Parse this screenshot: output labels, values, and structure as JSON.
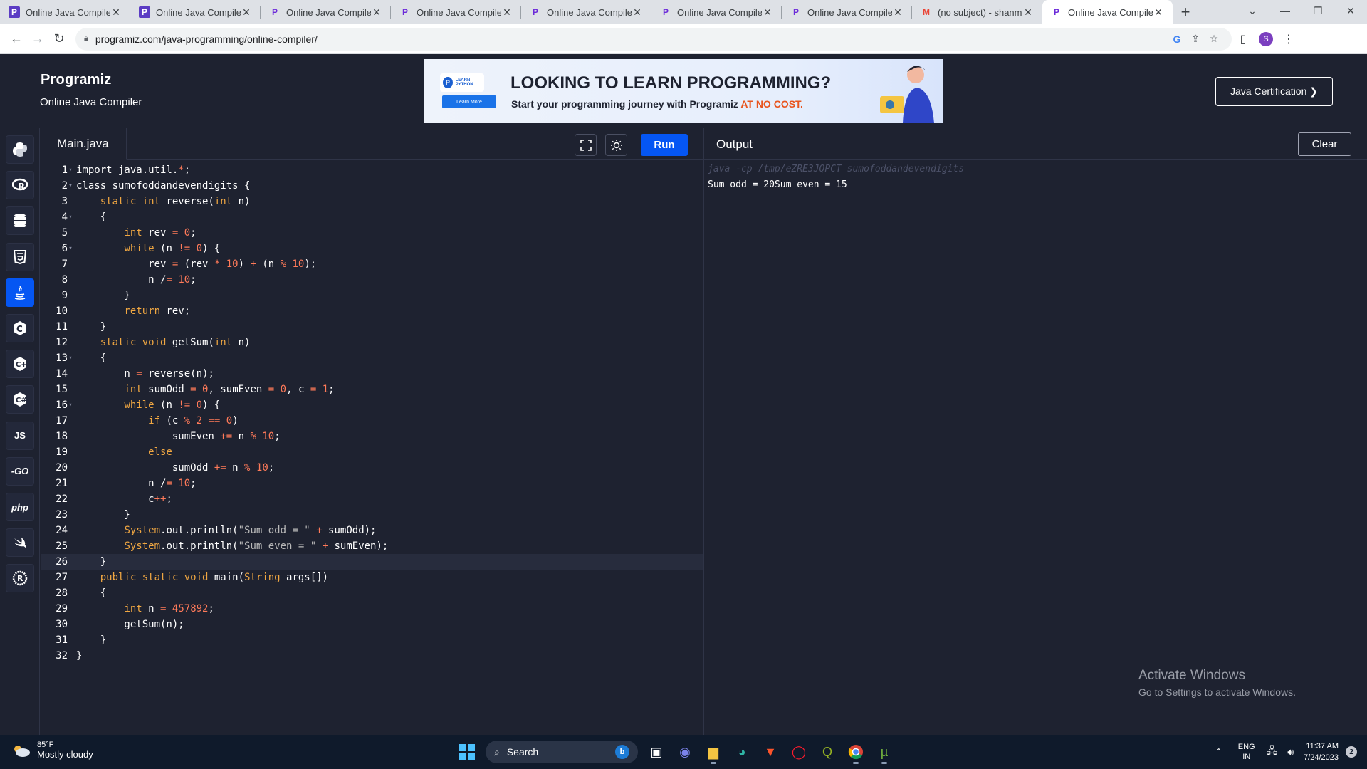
{
  "browser": {
    "tabs": [
      {
        "title": "Online Java Compiler",
        "favicon": "programiz-box-icon",
        "active": false
      },
      {
        "title": "Online Java Compiler",
        "favicon": "programiz-box-icon",
        "active": false
      },
      {
        "title": "Online Java Compiler",
        "favicon": "programiz-icon",
        "active": false
      },
      {
        "title": "Online Java Compiler",
        "favicon": "programiz-icon",
        "active": false
      },
      {
        "title": "Online Java Compiler",
        "favicon": "programiz-icon",
        "active": false
      },
      {
        "title": "Online Java Compiler",
        "favicon": "programiz-icon",
        "active": false
      },
      {
        "title": "Online Java Compiler",
        "favicon": "programiz-icon",
        "active": false
      },
      {
        "title": "(no subject) - shanmu",
        "favicon": "gmail-icon",
        "active": false
      },
      {
        "title": "Online Java Compiler",
        "favicon": "programiz-icon",
        "active": true
      }
    ],
    "url": "programiz.com/java-programming/online-compiler/",
    "profile_initial": "S"
  },
  "site": {
    "logo": "Programiz",
    "subtitle": "Online Java Compiler",
    "banner": {
      "badge": "LEARN PYTHON",
      "learn_more": "Learn More",
      "title": "LOOKING TO LEARN PROGRAMMING?",
      "subtitle_prefix": "Start your programming journey with Programiz ",
      "subtitle_highlight": "AT NO COST.",
      "highlight_color": "#e8541e"
    },
    "certification_button": "Java Certification ❯"
  },
  "sidebar": {
    "languages": [
      {
        "name": "python-icon",
        "label": "",
        "active": false
      },
      {
        "name": "r-icon",
        "label": "",
        "active": false
      },
      {
        "name": "sql-icon",
        "label": "",
        "active": false
      },
      {
        "name": "html-icon",
        "label": "",
        "active": false
      },
      {
        "name": "java-icon",
        "label": "",
        "active": true
      },
      {
        "name": "c-icon",
        "label": "",
        "active": false
      },
      {
        "name": "cpp-icon",
        "label": "",
        "active": false
      },
      {
        "name": "csharp-icon",
        "label": "",
        "active": false
      },
      {
        "name": "javascript-icon",
        "label": "JS",
        "active": false
      },
      {
        "name": "go-icon",
        "label": "-GO",
        "active": false
      },
      {
        "name": "php-icon",
        "label": "php",
        "active": false
      },
      {
        "name": "swift-icon",
        "label": "",
        "active": false
      },
      {
        "name": "rust-icon",
        "label": "",
        "active": false
      }
    ],
    "accent": "#0556f3"
  },
  "editor": {
    "file_tab": "Main.java",
    "run_label": "Run",
    "cursor_line": 26,
    "lines": [
      [
        [
          "import java.util.",
          ""
        ],
        [
          "*",
          "o"
        ],
        [
          ";",
          ""
        ]
      ],
      [
        [
          "class sumofoddandevendigits {",
          ""
        ]
      ],
      [
        [
          "    ",
          ""
        ],
        [
          "static int",
          "k"
        ],
        [
          " reverse(",
          ""
        ],
        [
          "int",
          "k"
        ],
        [
          " n)",
          ""
        ]
      ],
      [
        [
          "    {",
          ""
        ]
      ],
      [
        [
          "        ",
          ""
        ],
        [
          "int",
          "k"
        ],
        [
          " rev ",
          ""
        ],
        [
          "=",
          "o"
        ],
        [
          " ",
          ""
        ],
        [
          "0",
          "n"
        ],
        [
          ";",
          ""
        ]
      ],
      [
        [
          "        ",
          ""
        ],
        [
          "while",
          "k"
        ],
        [
          " (n ",
          ""
        ],
        [
          "!=",
          "o"
        ],
        [
          " ",
          ""
        ],
        [
          "0",
          "n"
        ],
        [
          ") {",
          ""
        ]
      ],
      [
        [
          "            rev ",
          ""
        ],
        [
          "=",
          "o"
        ],
        [
          " (rev ",
          ""
        ],
        [
          "*",
          "o"
        ],
        [
          " ",
          ""
        ],
        [
          "10",
          "n"
        ],
        [
          ") ",
          ""
        ],
        [
          "+",
          "o"
        ],
        [
          " (n ",
          ""
        ],
        [
          "%",
          "o"
        ],
        [
          " ",
          ""
        ],
        [
          "10",
          "n"
        ],
        [
          ");",
          ""
        ]
      ],
      [
        [
          "            n /",
          ""
        ],
        [
          "=",
          "o"
        ],
        [
          " ",
          ""
        ],
        [
          "10",
          "n"
        ],
        [
          ";",
          ""
        ]
      ],
      [
        [
          "        }",
          ""
        ]
      ],
      [
        [
          "        ",
          ""
        ],
        [
          "return",
          "k"
        ],
        [
          " rev;",
          ""
        ]
      ],
      [
        [
          "    }",
          ""
        ]
      ],
      [
        [
          "    ",
          ""
        ],
        [
          "static void",
          "k"
        ],
        [
          " getSum(",
          ""
        ],
        [
          "int",
          "k"
        ],
        [
          " n)",
          ""
        ]
      ],
      [
        [
          "    {",
          ""
        ]
      ],
      [
        [
          "        n ",
          ""
        ],
        [
          "=",
          "o"
        ],
        [
          " reverse(n);",
          ""
        ]
      ],
      [
        [
          "        ",
          ""
        ],
        [
          "int",
          "k"
        ],
        [
          " sumOdd ",
          ""
        ],
        [
          "=",
          "o"
        ],
        [
          " ",
          ""
        ],
        [
          "0",
          "n"
        ],
        [
          ", sumEven ",
          ""
        ],
        [
          "=",
          "o"
        ],
        [
          " ",
          ""
        ],
        [
          "0",
          "n"
        ],
        [
          ", c ",
          ""
        ],
        [
          "=",
          "o"
        ],
        [
          " ",
          ""
        ],
        [
          "1",
          "n"
        ],
        [
          ";",
          ""
        ]
      ],
      [
        [
          "        ",
          ""
        ],
        [
          "while",
          "k"
        ],
        [
          " (n ",
          ""
        ],
        [
          "!=",
          "o"
        ],
        [
          " ",
          ""
        ],
        [
          "0",
          "n"
        ],
        [
          ") {",
          ""
        ]
      ],
      [
        [
          "            ",
          ""
        ],
        [
          "if",
          "k"
        ],
        [
          " (c ",
          ""
        ],
        [
          "%",
          "o"
        ],
        [
          " ",
          ""
        ],
        [
          "2",
          "n"
        ],
        [
          " ",
          ""
        ],
        [
          "==",
          "o"
        ],
        [
          " ",
          ""
        ],
        [
          "0",
          "n"
        ],
        [
          ")",
          ""
        ]
      ],
      [
        [
          "                sumEven ",
          ""
        ],
        [
          "+=",
          "o"
        ],
        [
          " n ",
          ""
        ],
        [
          "%",
          "o"
        ],
        [
          " ",
          ""
        ],
        [
          "10",
          "n"
        ],
        [
          ";",
          ""
        ]
      ],
      [
        [
          "            ",
          ""
        ],
        [
          "else",
          "k"
        ]
      ],
      [
        [
          "                sumOdd ",
          ""
        ],
        [
          "+=",
          "o"
        ],
        [
          " n ",
          ""
        ],
        [
          "%",
          "o"
        ],
        [
          " ",
          ""
        ],
        [
          "10",
          "n"
        ],
        [
          ";",
          ""
        ]
      ],
      [
        [
          "            n /",
          ""
        ],
        [
          "=",
          "o"
        ],
        [
          " ",
          ""
        ],
        [
          "10",
          "n"
        ],
        [
          ";",
          ""
        ]
      ],
      [
        [
          "            c",
          ""
        ],
        [
          "++",
          "o"
        ],
        [
          ";",
          ""
        ]
      ],
      [
        [
          "        }",
          ""
        ]
      ],
      [
        [
          "        ",
          ""
        ],
        [
          "System",
          "k"
        ],
        [
          ".out.println(",
          ""
        ],
        [
          "\"Sum odd = \"",
          "s"
        ],
        [
          " ",
          ""
        ],
        [
          "+",
          "o"
        ],
        [
          " sumOdd);",
          ""
        ]
      ],
      [
        [
          "        ",
          ""
        ],
        [
          "System",
          "k"
        ],
        [
          ".out.println(",
          ""
        ],
        [
          "\"Sum even = \"",
          "s"
        ],
        [
          " ",
          ""
        ],
        [
          "+",
          "o"
        ],
        [
          " sumEven);",
          ""
        ]
      ],
      [
        [
          "    }",
          ""
        ]
      ],
      [
        [
          "    ",
          ""
        ],
        [
          "public static void",
          "k"
        ],
        [
          " main(",
          ""
        ],
        [
          "String",
          "k"
        ],
        [
          " args[])",
          ""
        ]
      ],
      [
        [
          "    {",
          ""
        ]
      ],
      [
        [
          "        ",
          ""
        ],
        [
          "int",
          "k"
        ],
        [
          " n ",
          ""
        ],
        [
          "=",
          "o"
        ],
        [
          " ",
          ""
        ],
        [
          "457892",
          "n"
        ],
        [
          ";",
          ""
        ]
      ],
      [
        [
          "        getSum(n);",
          ""
        ]
      ],
      [
        [
          "    }",
          ""
        ]
      ],
      [
        [
          "}",
          ""
        ]
      ]
    ],
    "foldable": [
      1,
      2,
      4,
      6,
      13,
      16
    ]
  },
  "output": {
    "title": "Output",
    "clear_label": "Clear",
    "command": "java -cp /tmp/eZRE3JQPCT sumofoddandevendigits",
    "result": "Sum odd = 20Sum even = 15"
  },
  "watermark": {
    "title": "Activate Windows",
    "subtitle": "Go to Settings to activate Windows."
  },
  "taskbar": {
    "temperature": "85°F",
    "condition": "Mostly cloudy",
    "search_label": "Search",
    "lang_top": "ENG",
    "lang_bottom": "IN",
    "time": "11:37 AM",
    "date": "7/24/2023",
    "notifications": "2"
  }
}
